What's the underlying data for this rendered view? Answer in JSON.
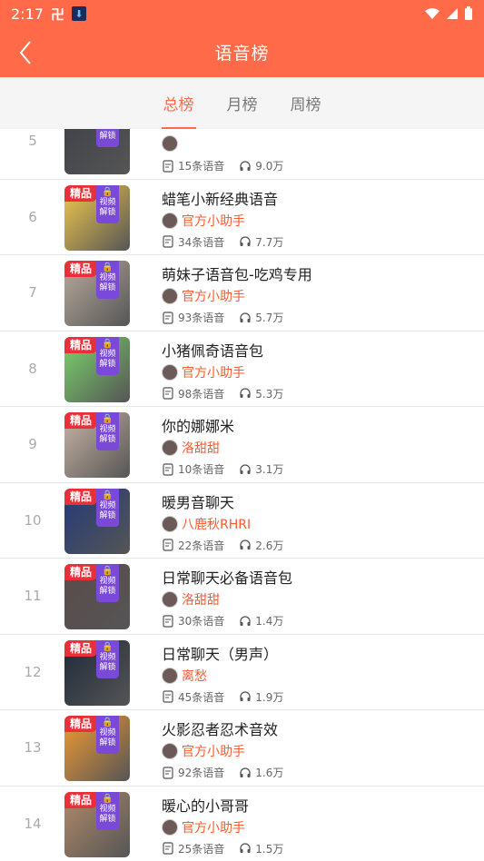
{
  "status_bar": {
    "time": "2:17",
    "glyph": "卍"
  },
  "header": {
    "title": "语音榜"
  },
  "tabs": [
    {
      "label": "总榜",
      "active": true
    },
    {
      "label": "月榜",
      "active": false
    },
    {
      "label": "周榜",
      "active": false
    }
  ],
  "colors": {
    "accent": "#ff6a48",
    "author": "#ff5a2e",
    "badge": "#e9303a",
    "lock": "#7a49d8"
  },
  "labels": {
    "premium_badge": "精品",
    "video_unlock_1": "视频",
    "video_unlock_2": "解锁"
  },
  "items": [
    {
      "rank": "5",
      "title": "",
      "author": "",
      "voices": "15条语音",
      "plays": "9.0万",
      "premium": false,
      "thumb": "#3f4148"
    },
    {
      "rank": "6",
      "title": "蜡笔小新经典语音",
      "author": "官方小助手",
      "voices": "34条语音",
      "plays": "7.7万",
      "premium": true,
      "thumb": "#f2c94c"
    },
    {
      "rank": "7",
      "title": "萌妹子语音包-吃鸡专用",
      "author": "官方小助手",
      "voices": "93条语音",
      "plays": "5.7万",
      "premium": true,
      "thumb": "#b9ab9d"
    },
    {
      "rank": "8",
      "title": "小猪佩奇语音包",
      "author": "官方小助手",
      "voices": "98条语音",
      "plays": "5.3万",
      "premium": true,
      "thumb": "#7bd36b"
    },
    {
      "rank": "9",
      "title": "你的娜娜米",
      "author": "洛甜甜",
      "voices": "10条语音",
      "plays": "3.1万",
      "premium": true,
      "thumb": "#c9b4a5"
    },
    {
      "rank": "10",
      "title": "暖男音聊天",
      "author": "八鹿秋RHRI",
      "voices": "22条语音",
      "plays": "2.6万",
      "premium": true,
      "thumb": "#233a7a"
    },
    {
      "rank": "11",
      "title": "日常聊天必备语音包",
      "author": "洛甜甜",
      "voices": "30条语音",
      "plays": "1.4万",
      "premium": true,
      "thumb": "#5a4b4b"
    },
    {
      "rank": "12",
      "title": "日常聊天（男声）",
      "author": "离愁",
      "voices": "45条语音",
      "plays": "1.9万",
      "premium": true,
      "thumb": "#1e2a3a"
    },
    {
      "rank": "13",
      "title": "火影忍者忍术音效",
      "author": "官方小助手",
      "voices": "92条语音",
      "plays": "1.6万",
      "premium": true,
      "thumb": "#f29b32"
    },
    {
      "rank": "14",
      "title": "暖心的小哥哥",
      "author": "官方小助手",
      "voices": "25条语音",
      "plays": "1.5万",
      "premium": true,
      "thumb": "#b08a6a"
    }
  ]
}
